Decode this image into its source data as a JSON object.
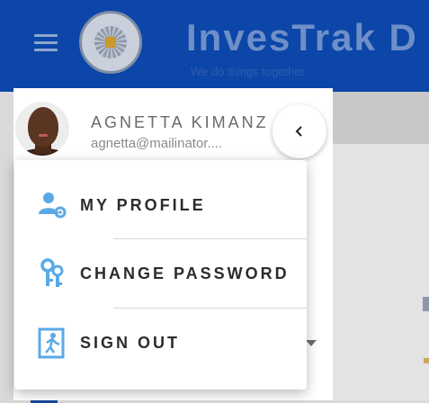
{
  "app": {
    "title": "InvesTrak D",
    "tagline": "We do things together"
  },
  "user": {
    "name": "AGNETTA KIMANZ",
    "email": "agnetta@mailinator...."
  },
  "menu": {
    "items": [
      {
        "label": "MY PROFILE",
        "icon": "user-settings-icon"
      },
      {
        "label": "CHANGE PASSWORD",
        "icon": "keys-icon"
      },
      {
        "label": "SIGN OUT",
        "icon": "exit-door-icon"
      }
    ]
  },
  "colors": {
    "appbar": "#0b46a8",
    "icon_accent": "#5aa9e6"
  }
}
